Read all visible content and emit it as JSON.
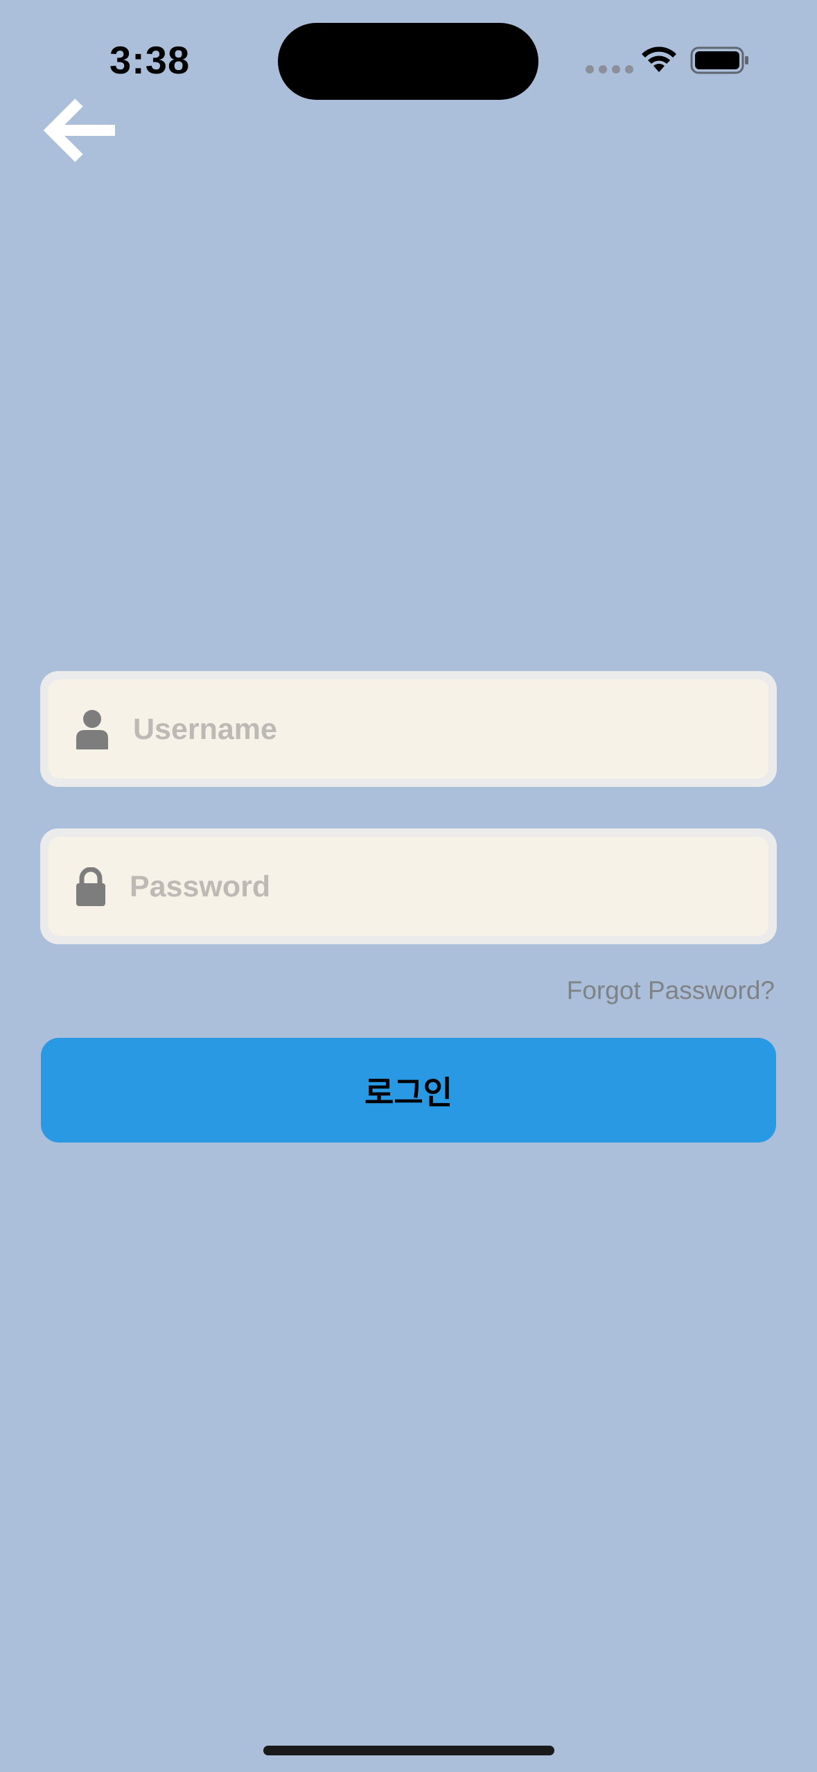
{
  "status_bar": {
    "time": "3:38"
  },
  "nav": {
    "back_icon": "arrow-left-icon"
  },
  "form": {
    "username": {
      "icon": "user-icon",
      "placeholder": "Username",
      "value": ""
    },
    "password": {
      "icon": "lock-icon",
      "placeholder": "Password",
      "value": ""
    },
    "forgot_password_label": "Forgot Password?",
    "login_label": "로그인"
  },
  "colors": {
    "background": "#abbfdb",
    "field_fill": "#f7f2e8",
    "field_border": "#ebebeb",
    "login_button": "#2a99e3",
    "placeholder": "#bdbab6",
    "icon_gray": "#7d7d7d"
  }
}
